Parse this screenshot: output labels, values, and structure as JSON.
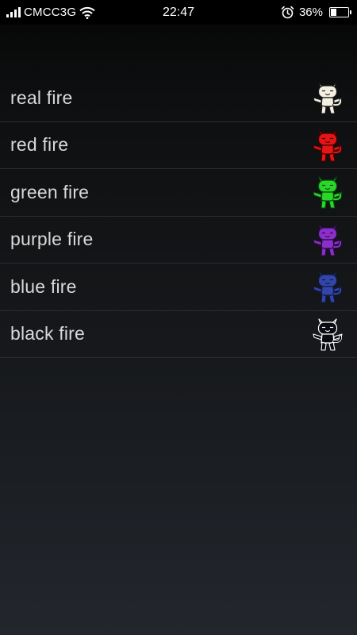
{
  "status_bar": {
    "carrier": "CMCC3G",
    "time": "22:47",
    "battery_percent_text": "36%",
    "battery_level": 0.36,
    "signal_icon": "signal-bars-icon",
    "wifi_icon": "wifi-icon",
    "alarm_icon": "alarm-clock-icon",
    "battery_icon": "battery-icon"
  },
  "list": {
    "items": [
      {
        "label": "real fire",
        "icon": "cat-icon",
        "color": "#f4f0e0",
        "outline": "#1a1a1a"
      },
      {
        "label": "red fire",
        "icon": "cat-icon",
        "color": "#e31515",
        "outline": "#4a0000"
      },
      {
        "label": "green fire",
        "icon": "cat-icon",
        "color": "#2bd62b",
        "outline": "#0a4a0a"
      },
      {
        "label": "purple fire",
        "icon": "cat-icon",
        "color": "#8a2fc9",
        "outline": "#2b0a45"
      },
      {
        "label": "blue fire",
        "icon": "cat-icon",
        "color": "#3346a8",
        "outline": "#101a45"
      },
      {
        "label": "black fire",
        "icon": "cat-icon",
        "color": "#0a0a12",
        "outline": "#ffffff"
      }
    ]
  }
}
